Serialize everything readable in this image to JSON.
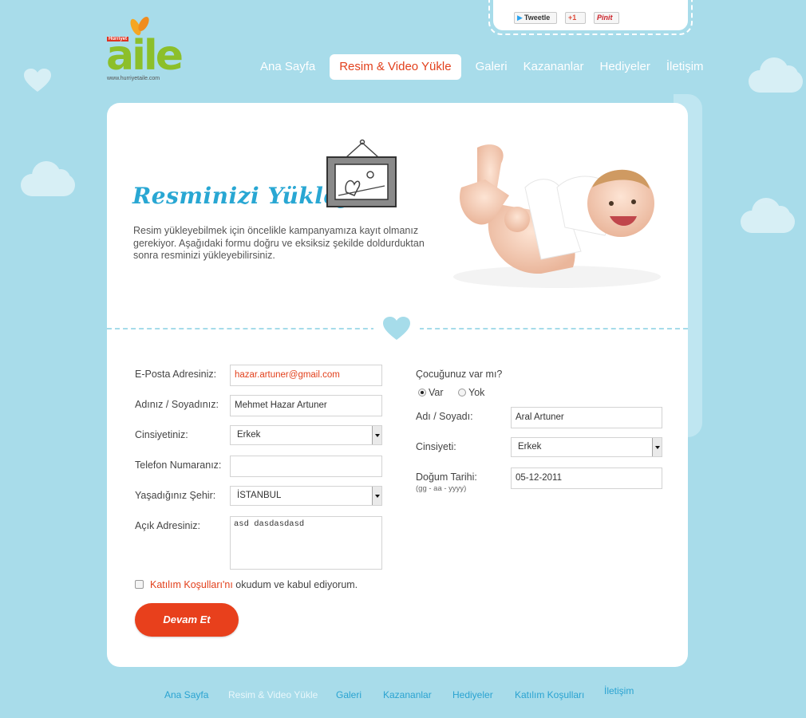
{
  "brand": {
    "top_label": "Hürriyet",
    "logo_text": "aile",
    "url": "www.hurriyetaile.com"
  },
  "social": {
    "tweet": "Tweetle",
    "gplus": "+1",
    "pin": "Pinit"
  },
  "nav": {
    "items": [
      {
        "label": "Ana Sayfa"
      },
      {
        "label": "Resim & Video Yükle"
      },
      {
        "label": "Galeri"
      },
      {
        "label": "Kazananlar"
      },
      {
        "label": "Hediyeler"
      },
      {
        "label": "İletişim"
      }
    ],
    "active_index": 1
  },
  "hero": {
    "title": "Resminizi Yükleyin",
    "description": "Resim yükleyebilmek için öncelikle kampanyamıza kayıt olmanız gerekiyor. Aşağıdaki formu doğru ve eksiksiz şekilde doldurduktan sonra resminizi yükleyebilirsiniz."
  },
  "form_left": {
    "email_label": "E-Posta Adresiniz:",
    "email_value": "hazar.artuner@gmail.com",
    "name_label": "Adınız / Soyadınız:",
    "name_value": "Mehmet Hazar Artuner",
    "gender_label": "Cinsiyetiniz:",
    "gender_value": "Erkek",
    "phone_label": "Telefon Numaranız:",
    "phone_value": "",
    "city_label": "Yaşadığınız Şehir:",
    "city_value": "İSTANBUL",
    "address_label": "Açık Adresiniz:",
    "address_value": "asd dasdasdasd"
  },
  "form_right": {
    "has_child_label": "Çocuğunuz var mı?",
    "yes_label": "Var",
    "no_label": "Yok",
    "selected": "Var",
    "child_name_label": "Adı / Soyadı:",
    "child_name_value": "Aral Artuner",
    "child_gender_label": "Cinsiyeti:",
    "child_gender_value": "Erkek",
    "birth_label": "Doğum Tarihi:",
    "birth_hint": "(gg - aa - yyyy)",
    "birth_value": "05-12-2011"
  },
  "terms": {
    "link": "Katılım Koşulları'nı",
    "text": " okudum ve kabul ediyorum."
  },
  "submit_label": "Devam Et",
  "footer": {
    "items": [
      {
        "label": "Ana Sayfa"
      },
      {
        "label": "Resim & Video Yükle"
      },
      {
        "label": "Galeri"
      },
      {
        "label": "Kazananlar"
      },
      {
        "label": "Hediyeler"
      },
      {
        "label": "Katılım Koşulları"
      },
      {
        "label": "İletişim"
      }
    ]
  },
  "colors": {
    "accent": "#e2401c",
    "sky": "#a8dcea",
    "brand_green": "#8cbf2a",
    "title_blue": "#29a7d3"
  }
}
